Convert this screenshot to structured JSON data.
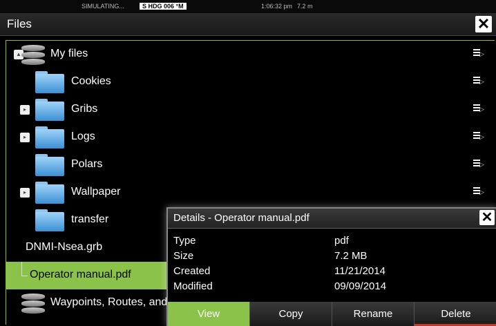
{
  "status": {
    "simulating": "SIMULATING...",
    "hdg": "S HDG 006 °M",
    "time": "1:06:32 pm",
    "depth": "7.2 m"
  },
  "window": {
    "title": "Files",
    "close": "✕"
  },
  "list": {
    "root_label": "My files",
    "items": [
      {
        "label": "Cookies"
      },
      {
        "label": "Gribs"
      },
      {
        "label": "Logs"
      },
      {
        "label": "Polars"
      },
      {
        "label": "Wallpaper"
      },
      {
        "label": "transfer"
      }
    ],
    "files": [
      {
        "label": "DNMI-Nsea.grb"
      },
      {
        "label": "Operator manual.pdf"
      }
    ],
    "waypoints_label": "Waypoints, Routes, and T"
  },
  "details": {
    "title": "Details - Operator manual.pdf",
    "close": "✕",
    "rows": [
      {
        "key": "Type",
        "value": "pdf"
      },
      {
        "key": "Size",
        "value": "7.2 MB"
      },
      {
        "key": "Created",
        "value": "11/21/2014"
      },
      {
        "key": "Modified",
        "value": "09/09/2014"
      }
    ],
    "buttons": {
      "view": "View",
      "copy": "Copy",
      "rename": "Rename",
      "delete": "Delete"
    }
  },
  "colors": {
    "accent": "#8bc34a",
    "folder": "#4a9de0",
    "delete_indicator": "#c0392b"
  }
}
